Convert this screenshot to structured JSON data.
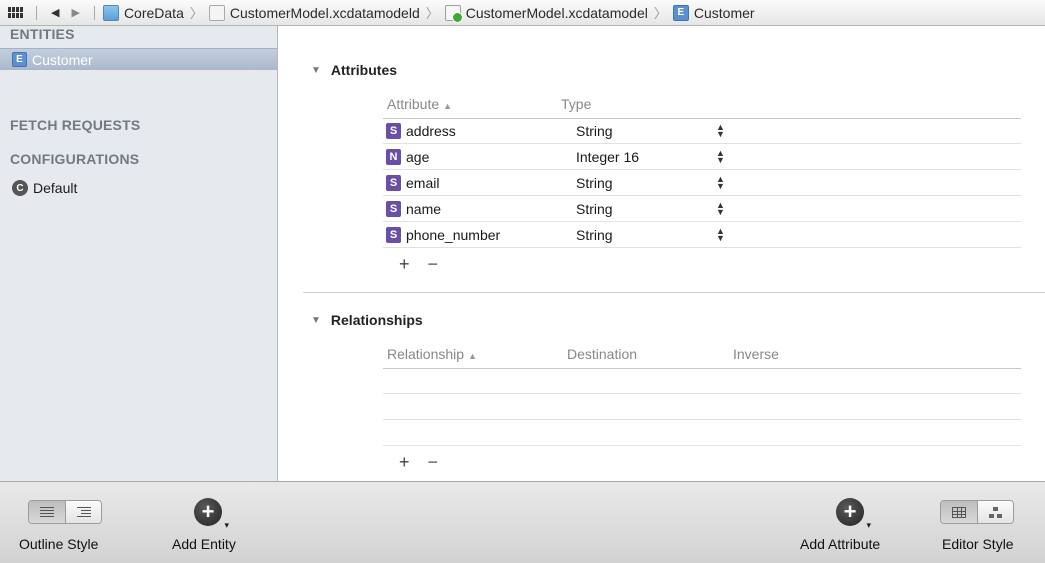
{
  "jumpbar": {
    "crumbs": [
      "CoreData",
      "CustomerModel.xcdatamodeld",
      "CustomerModel.xcdatamodel",
      "Customer"
    ],
    "entity_badge": "E"
  },
  "sidebar": {
    "entities_header": "ENTITIES",
    "entities": [
      {
        "badge": "E",
        "label": "Customer",
        "selected": true
      }
    ],
    "fetch_header": "FETCH REQUESTS",
    "config_header": "CONFIGURATIONS",
    "configurations": [
      {
        "badge": "C",
        "label": "Default"
      }
    ]
  },
  "attributes": {
    "title": "Attributes",
    "columns": {
      "attribute": "Attribute",
      "type": "Type"
    },
    "rows": [
      {
        "badge": "S",
        "name": "address",
        "type": "String"
      },
      {
        "badge": "N",
        "name": "age",
        "type": "Integer 16"
      },
      {
        "badge": "S",
        "name": "email",
        "type": "String"
      },
      {
        "badge": "S",
        "name": "name",
        "type": "String"
      },
      {
        "badge": "S",
        "name": "phone_number",
        "type": "String"
      }
    ],
    "add": "+",
    "remove": "−"
  },
  "relationships": {
    "title": "Relationships",
    "columns": {
      "relationship": "Relationship",
      "destination": "Destination",
      "inverse": "Inverse"
    },
    "add": "+",
    "remove": "−"
  },
  "bottom": {
    "outline_style": "Outline Style",
    "add_entity": "Add Entity",
    "add_attribute": "Add Attribute",
    "editor_style": "Editor Style"
  },
  "colors": {
    "sidebar_bg": "#e6e9ee",
    "selection": "#a9b8cc",
    "attribute_badge": "#6b4ea6",
    "entity_badge": "#5e8fd0"
  }
}
